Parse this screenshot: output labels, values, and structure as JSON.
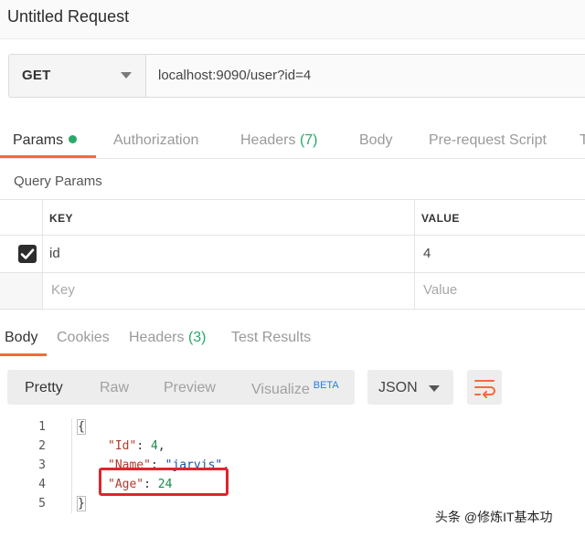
{
  "window": {
    "title": "Untitled Request"
  },
  "request": {
    "method": "GET",
    "url": "localhost:9090/user?id=4"
  },
  "request_tabs": [
    {
      "label": "Params",
      "active": true,
      "indicator": "green-dot"
    },
    {
      "label": "Authorization"
    },
    {
      "label": "Headers",
      "count": "(7)"
    },
    {
      "label": "Body"
    },
    {
      "label": "Pre-request Script"
    },
    {
      "label": "T"
    }
  ],
  "query_params": {
    "section_title": "Query Params",
    "columns": [
      "KEY",
      "VALUE"
    ],
    "rows": [
      {
        "checked": true,
        "key": "id",
        "value": "4"
      }
    ],
    "placeholder": {
      "key": "Key",
      "value": "Value"
    }
  },
  "response_tabs": [
    {
      "label": "Body",
      "active": true
    },
    {
      "label": "Cookies"
    },
    {
      "label": "Headers",
      "count": "(3)"
    },
    {
      "label": "Test Results"
    }
  ],
  "response_toolbar": {
    "formats": [
      "Pretty",
      "Raw",
      "Preview",
      "Visualize"
    ],
    "active": "Pretty",
    "visualize_badge": "BETA",
    "language": "JSON",
    "wrap_icon": "wrap-lines-icon"
  },
  "response_body": {
    "line_numbers": [
      "1",
      "2",
      "3",
      "4",
      "5"
    ],
    "lines": [
      {
        "text": "{"
      },
      {
        "key": "\"Id\"",
        "sep": ": ",
        "value": "4",
        "trail": ","
      },
      {
        "key": "\"Name\"",
        "sep": ": ",
        "value": "\"jarvis\"",
        "trail": ","
      },
      {
        "key": "\"Age\"",
        "sep": ": ",
        "value": "24",
        "trail": ""
      },
      {
        "text": "}"
      }
    ]
  },
  "colors": {
    "accent": "#f26b3a",
    "status_green": "#2aa86a",
    "highlight_red": "#e0252d",
    "beta_blue": "#2a7be4"
  },
  "watermark": "头条 @修炼IT基本功"
}
